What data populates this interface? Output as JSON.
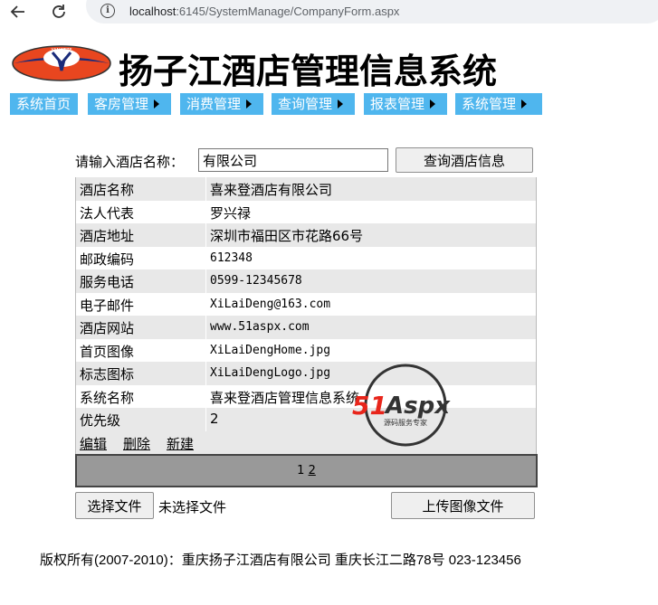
{
  "browser": {
    "url_host": "localhost",
    "url_rest": ":6145/SystemManage/CompanyForm.aspx"
  },
  "header": {
    "title": "扬子江酒店管理信息系统"
  },
  "menu": {
    "items": [
      {
        "label": "系统首页",
        "has_arrow": false
      },
      {
        "label": "客房管理",
        "has_arrow": true
      },
      {
        "label": "消费管理",
        "has_arrow": true
      },
      {
        "label": "查询管理",
        "has_arrow": true
      },
      {
        "label": "报表管理",
        "has_arrow": true
      },
      {
        "label": "系统管理",
        "has_arrow": true
      }
    ]
  },
  "search": {
    "label": "请输入酒店名称：",
    "value": "有限公司",
    "button": "查询酒店信息"
  },
  "detail": {
    "rows": [
      {
        "key": "酒店名称",
        "value": "喜来登酒店有限公司"
      },
      {
        "key": "法人代表",
        "value": "罗兴禄"
      },
      {
        "key": "酒店地址",
        "value": "深圳市福田区市花路66号"
      },
      {
        "key": "邮政编码",
        "value": "612348"
      },
      {
        "key": "服务电话",
        "value": "0599-12345678"
      },
      {
        "key": "电子邮件",
        "value": "XiLaiDeng@163.com"
      },
      {
        "key": "酒店网站",
        "value": "www.51aspx.com"
      },
      {
        "key": "首页图像",
        "value": "XiLaiDengHome.jpg"
      },
      {
        "key": "标志图标",
        "value": "XiLaiDengLogo.jpg"
      },
      {
        "key": "系统名称",
        "value": "喜来登酒店管理信息系统"
      },
      {
        "key": "优先级",
        "value": "2"
      }
    ],
    "actions": {
      "edit": "编辑",
      "delete": "删除",
      "new": "新建"
    }
  },
  "pager": {
    "page1": "1",
    "page2": "2"
  },
  "upload": {
    "choose_button": "选择文件",
    "no_file": "未选择文件",
    "upload_button": "上传图像文件"
  },
  "footer": {
    "text": "版权所有(2007-2010)：重庆扬子江酒店有限公司 重庆长江二路78号 023-123456"
  },
  "watermark": {
    "brand": "51Aspx",
    "tagline": "源码服务专家"
  },
  "colors": {
    "menu_bg": "#4fb6ee",
    "row_alt": "#e8e8e8",
    "pager_bg": "#999999"
  }
}
